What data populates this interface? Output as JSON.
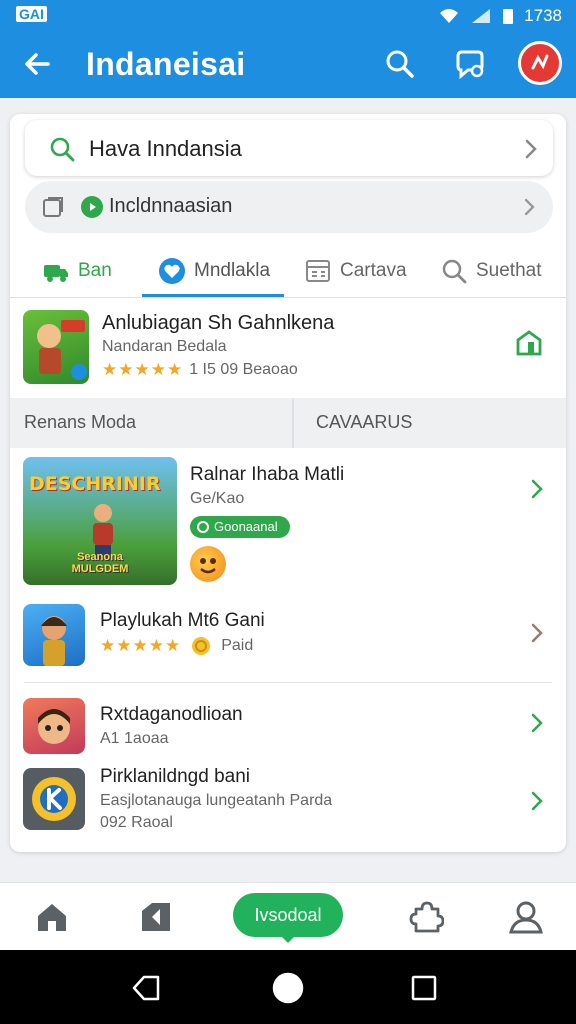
{
  "status_bar": {
    "carrier": "GAI",
    "time": "1738"
  },
  "app_bar": {
    "title": "Indaneisai"
  },
  "search": {
    "value": "Hava Inndansia"
  },
  "filter": {
    "value": "Incldnnaasian"
  },
  "tabs": [
    {
      "label": "Ban",
      "icon": "truck-icon"
    },
    {
      "label": "Mndlakla",
      "icon": "heart-icon"
    },
    {
      "label": "Cartava",
      "icon": "table-icon"
    },
    {
      "label": "Suethat",
      "icon": "search-icon"
    }
  ],
  "featured": {
    "title": "Anlubiagan Sh Gahnlkena",
    "subtitle": "Nandaran Bedala",
    "stars": "★★★★★",
    "rating_text": "1 I5 09 Beaoao"
  },
  "section": {
    "left": "Renans Moda",
    "right": "CAVAARUS"
  },
  "items": [
    {
      "name": "Ralnar Ihaba Matli",
      "sub": "Ge/Kao",
      "badge": "Goonaanal",
      "thumb_label_1": "DESCHRINIR",
      "thumb_label_2": "Seanona MULGDEM"
    },
    {
      "name": "Playlukah Mt6 Gani",
      "stars": "★★★★★",
      "sub": "Paid"
    },
    {
      "name": "Rxtdaganodlioan",
      "sub": "A1 1aoaa"
    },
    {
      "name": "Pirklanildngd bani",
      "sub": "Easjlotanauga lungeatanh Parda",
      "sub2": "092 Raoal"
    }
  ],
  "bottom_nav": {
    "active_label": "Ivsodoal"
  },
  "colors": {
    "primary": "#1e8fe0",
    "accent": "#2ea84a",
    "star": "#f5a623"
  }
}
